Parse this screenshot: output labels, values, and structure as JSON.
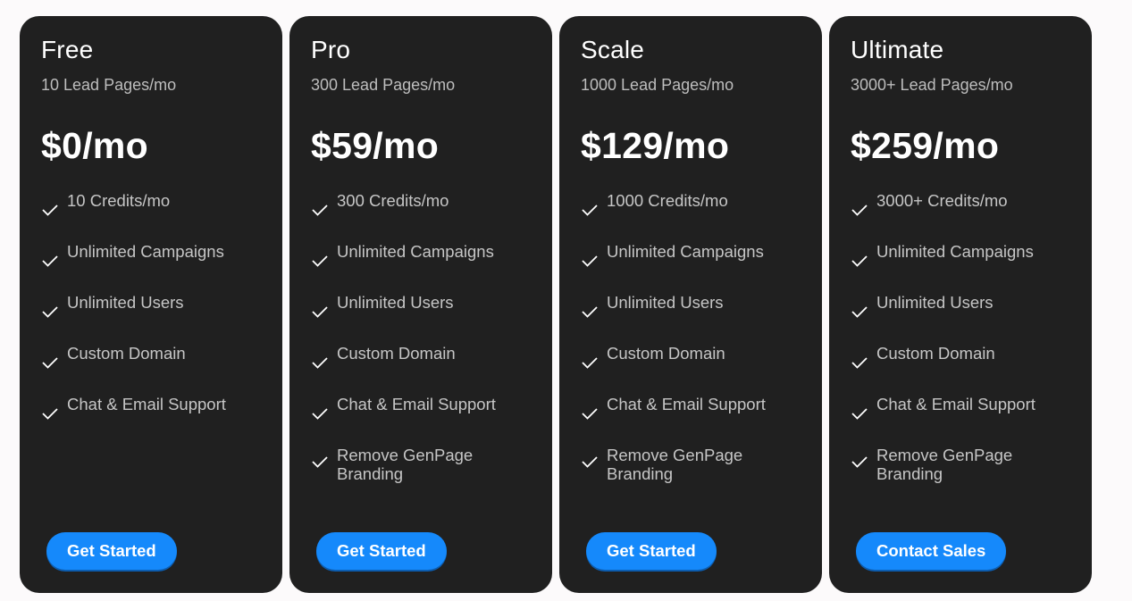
{
  "plans": [
    {
      "name": "Free",
      "subtitle": "10 Lead Pages/mo",
      "price": "$0/mo",
      "features": [
        "10 Credits/mo",
        "Unlimited Campaigns",
        "Unlimited Users",
        "Custom Domain",
        "Chat & Email Support"
      ],
      "cta": "Get Started"
    },
    {
      "name": "Pro",
      "subtitle": "300 Lead Pages/mo",
      "price": "$59/mo",
      "features": [
        "300 Credits/mo",
        "Unlimited Campaigns",
        "Unlimited Users",
        "Custom Domain",
        "Chat & Email Support",
        "Remove GenPage Branding"
      ],
      "cta": "Get Started"
    },
    {
      "name": "Scale",
      "subtitle": "1000 Lead Pages/mo",
      "price": "$129/mo",
      "features": [
        "1000 Credits/mo",
        "Unlimited Campaigns",
        "Unlimited Users",
        "Custom Domain",
        "Chat & Email Support",
        "Remove GenPage Branding"
      ],
      "cta": "Get Started"
    },
    {
      "name": "Ultimate",
      "subtitle": "3000+ Lead Pages/mo",
      "price": "$259/mo",
      "features": [
        "3000+ Credits/mo",
        "Unlimited Campaigns",
        "Unlimited Users",
        "Custom Domain",
        "Chat & Email Support",
        "Remove GenPage Branding"
      ],
      "cta": "Contact Sales"
    }
  ],
  "icons": {
    "feature_check": "check-icon"
  },
  "colors": {
    "card_bg": "#202020",
    "accent": "#1589fb",
    "page_bg": "#fcfafb"
  }
}
